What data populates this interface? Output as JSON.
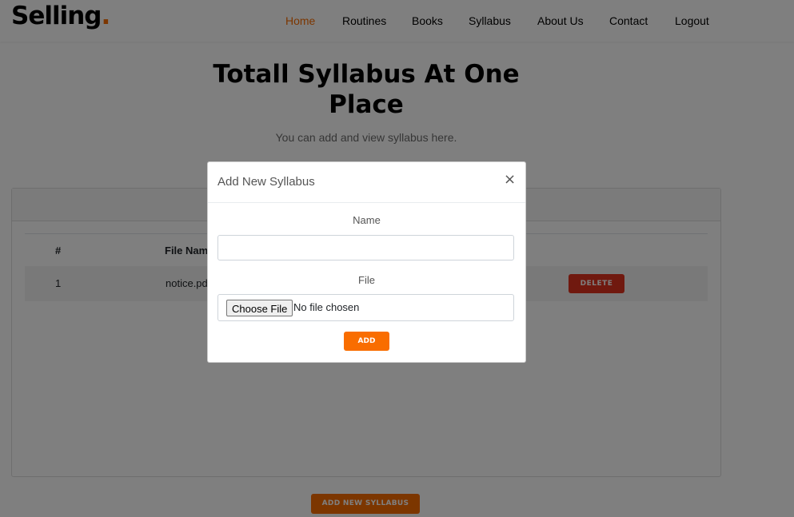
{
  "nav": {
    "brand_text": "Selling",
    "brand_dot": ".",
    "items": [
      {
        "label": "Home",
        "active": true
      },
      {
        "label": "Routines"
      },
      {
        "label": "Books"
      },
      {
        "label": "Syllabus"
      },
      {
        "label": "About Us"
      },
      {
        "label": "Contact"
      },
      {
        "label": "Logout"
      }
    ]
  },
  "hero": {
    "title": "Totall Syllabus At One Place",
    "subtitle": "You can add and view syllabus here."
  },
  "table": {
    "headers": [
      "#",
      "File Nam"
    ],
    "rows": [
      {
        "index": "1",
        "file": "notice.pd",
        "action": "DELETE"
      }
    ]
  },
  "add_new_button": "ADD NEW SYLLABUS",
  "modal": {
    "title": "Add New Syllabus",
    "close": "×",
    "name_label": "Name",
    "name_value": "",
    "file_label": "File",
    "choose_button": "Choose File",
    "no_file_text": "No file chosen",
    "submit": "ADD"
  },
  "colors": {
    "accent": "#f96d00",
    "danger": "#e0321e",
    "overlay": "rgba(0,0,0,0.5)"
  }
}
